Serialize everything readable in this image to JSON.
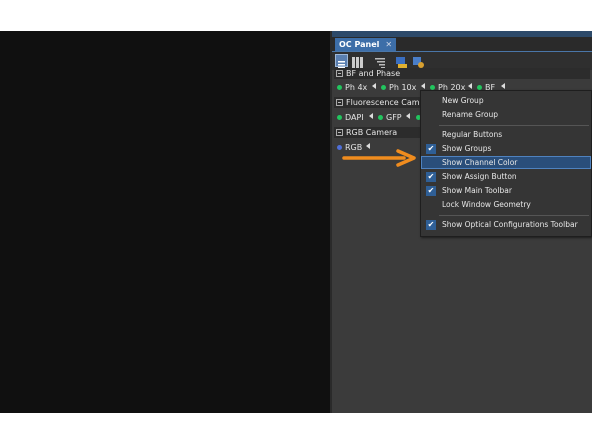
{
  "panel": {
    "tab_title": "OC Panel",
    "tab_close": "✕"
  },
  "toolbar": {
    "icons": [
      "groups-list-icon",
      "grid-icon",
      "sort-icon",
      "assign-icon",
      "settings-icon"
    ]
  },
  "groups": [
    {
      "name": "BF and Phase",
      "channels": [
        {
          "label": "Ph 4x",
          "color": "#22c55e"
        },
        {
          "label": "Ph 10x",
          "color": "#22c55e"
        },
        {
          "label": "Ph 20x",
          "color": "#22c55e"
        },
        {
          "label": "BF",
          "color": "#22c55e"
        }
      ]
    },
    {
      "name": "Fluorescence Camera",
      "channels": [
        {
          "label": "DAPI",
          "color": "#22c55e"
        },
        {
          "label": "GFP",
          "color": "#22c55e"
        }
      ]
    },
    {
      "name": "RGB Camera",
      "channels": [
        {
          "label": "RGB",
          "color": "#4f6fd8"
        }
      ]
    }
  ],
  "context_menu": {
    "items": [
      {
        "label": "New Group",
        "checked": false
      },
      {
        "label": "Rename Group",
        "checked": false
      },
      {
        "label": "Regular Buttons",
        "checked": false
      },
      {
        "label": "Show Groups",
        "checked": true
      },
      {
        "label": "Show Channel Color",
        "checked": false,
        "highlighted": true
      },
      {
        "label": "Show Assign Button",
        "checked": true
      },
      {
        "label": "Show Main Toolbar",
        "checked": true
      },
      {
        "label": "Lock Window Geometry",
        "checked": false
      },
      {
        "label": "Show Optical Configurations Toolbar",
        "checked": true
      }
    ],
    "check_glyph": "✔"
  },
  "colors": {
    "accent": "#3d6ea8",
    "arrow": "#f08c1e",
    "highlight": "#2a4e7a"
  }
}
